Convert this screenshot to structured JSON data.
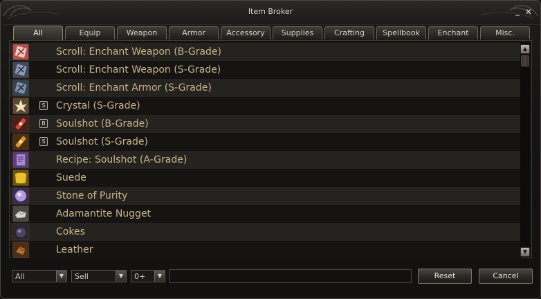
{
  "window": {
    "title": "Item Broker",
    "minimize_glyph": "_",
    "close_glyph": "✕"
  },
  "tabs": [
    {
      "label": "All",
      "active": true
    },
    {
      "label": "Equip"
    },
    {
      "label": "Weapon"
    },
    {
      "label": "Armor"
    },
    {
      "label": "Accessory"
    },
    {
      "label": "Supplies"
    },
    {
      "label": "Crafting"
    },
    {
      "label": "Spellbook"
    },
    {
      "label": "Enchant"
    },
    {
      "label": "Misc."
    }
  ],
  "items": [
    {
      "name": "Scroll: Enchant Weapon (B-Grade)",
      "grade": "",
      "icon": "scroll-icon"
    },
    {
      "name": "Scroll: Enchant Weapon (S-Grade)",
      "grade": "",
      "icon": "scroll-icon"
    },
    {
      "name": "Scroll: Enchant Armor (S-Grade)",
      "grade": "",
      "icon": "scroll-icon"
    },
    {
      "name": "Crystal (S-Grade)",
      "grade": "S",
      "icon": "crystal-icon"
    },
    {
      "name": "Soulshot (B-Grade)",
      "grade": "B",
      "icon": "soulshot-icon"
    },
    {
      "name": "Soulshot (S-Grade)",
      "grade": "S",
      "icon": "soulshot-icon"
    },
    {
      "name": "Recipe: Soulshot (A-Grade)",
      "grade": "",
      "icon": "recipe-icon"
    },
    {
      "name": "Suede",
      "grade": "",
      "icon": "suede-icon"
    },
    {
      "name": "Stone of Purity",
      "grade": "",
      "icon": "stone-icon"
    },
    {
      "name": "Adamantite Nugget",
      "grade": "",
      "icon": "nugget-icon"
    },
    {
      "name": "Cokes",
      "grade": "",
      "icon": "cokes-icon"
    },
    {
      "name": "Leather",
      "grade": "",
      "icon": "leather-icon"
    }
  ],
  "scrollbar": {
    "up_glyph": "▲",
    "down_glyph": "▼"
  },
  "filters": {
    "category": {
      "value": "All"
    },
    "trade_type": {
      "value": "Sell"
    },
    "enchant": {
      "value": "0+"
    },
    "arrow_glyph": "▼",
    "search": {
      "value": "",
      "placeholder": ""
    }
  },
  "buttons": {
    "reset": "Reset",
    "cancel": "Cancel"
  },
  "colors": {
    "item_text": "#c9b38b",
    "title_text": "#d8d4cc"
  }
}
